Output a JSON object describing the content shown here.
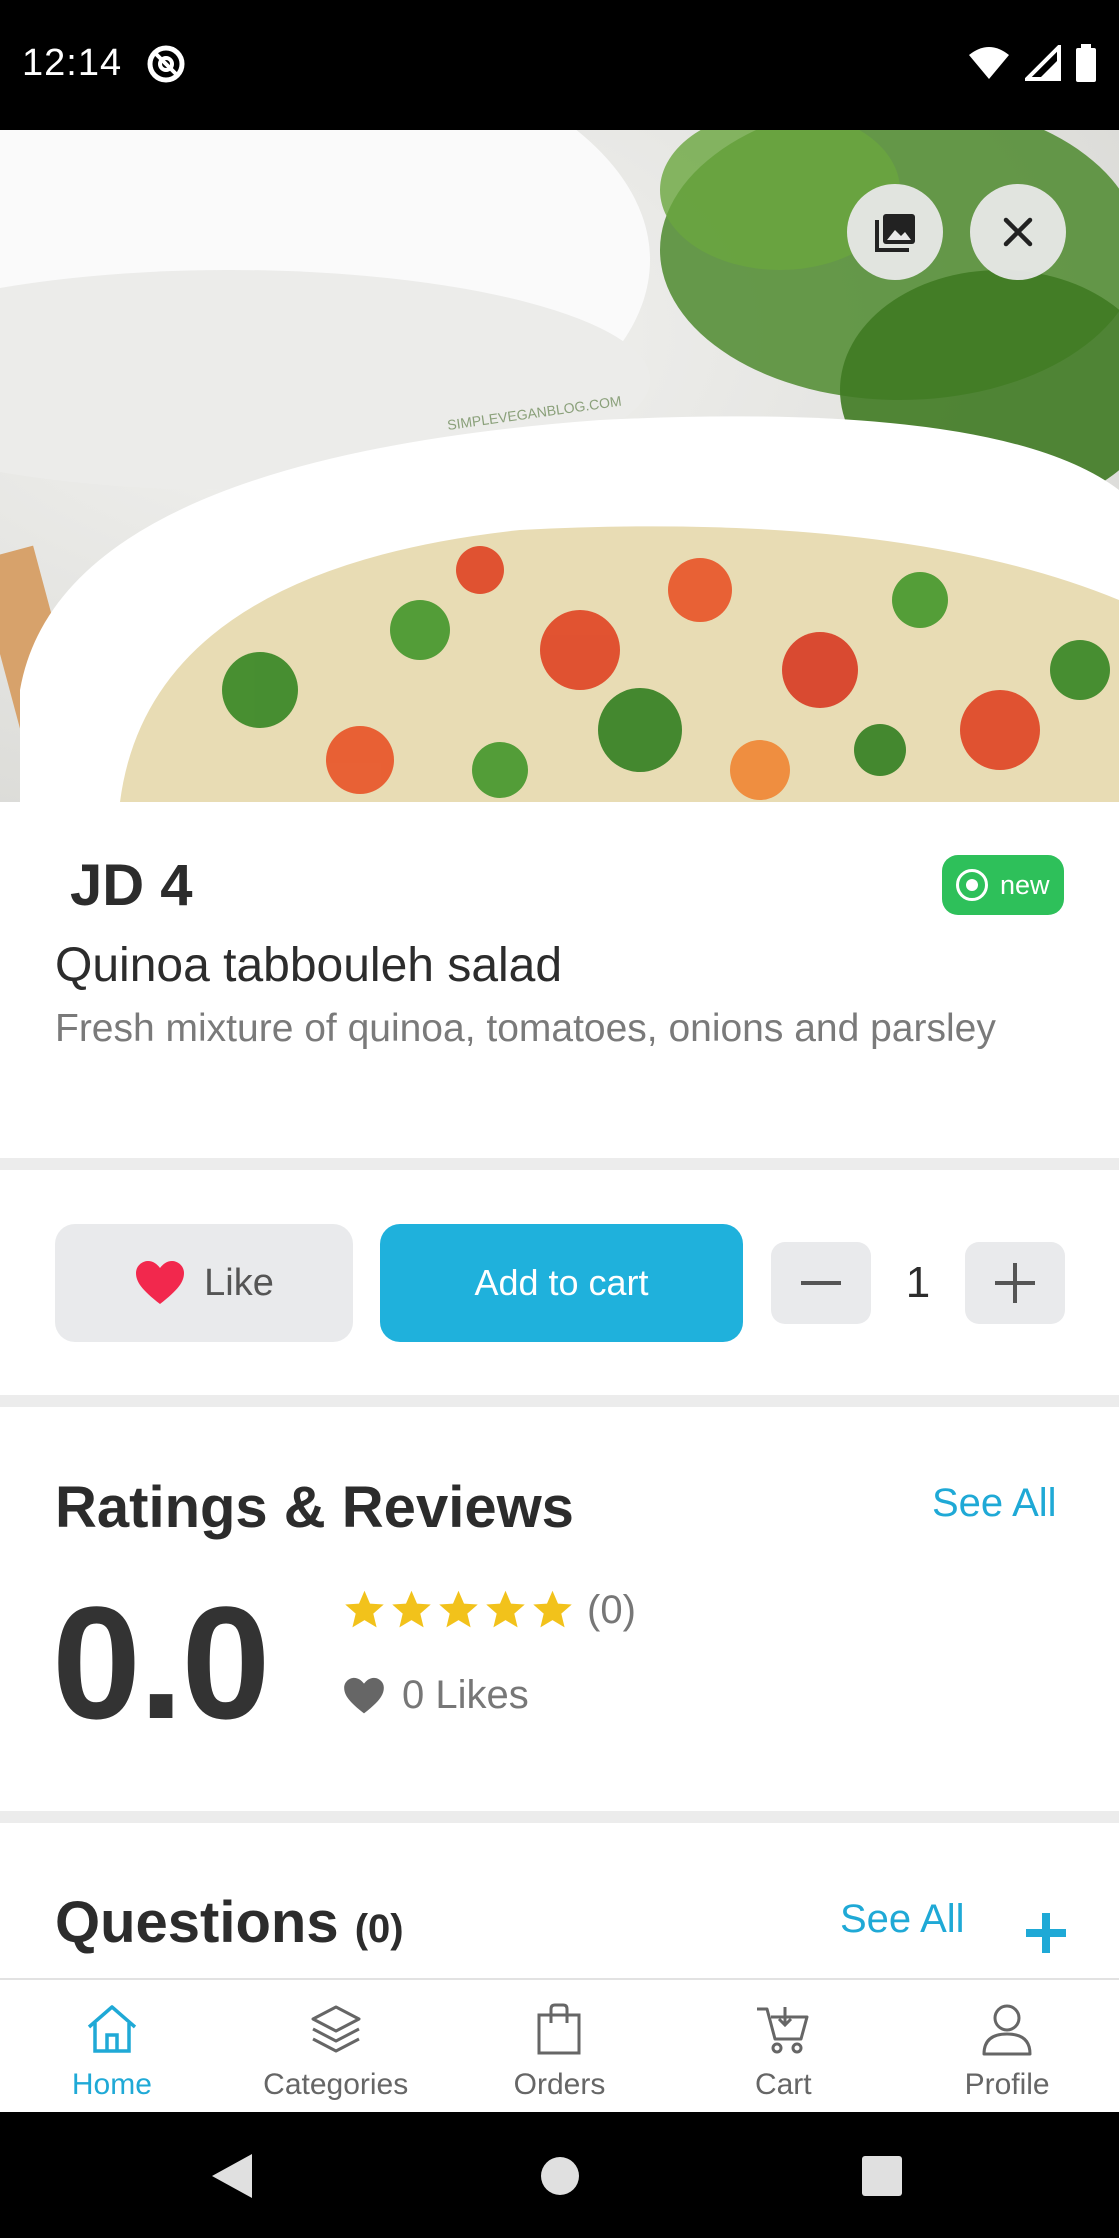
{
  "status_bar": {
    "time": "12:14"
  },
  "hero": {
    "watermark": "SIMPLEVEGANBLOG.COM"
  },
  "product": {
    "price": "JD 4",
    "badge": "new",
    "title": "Quinoa tabbouleh salad",
    "description": "Fresh mixture of quinoa, tomatoes, onions and parsley"
  },
  "actions": {
    "like_label": "Like",
    "add_to_cart_label": "Add to cart",
    "quantity": "1"
  },
  "ratings": {
    "title": "Ratings & Reviews",
    "see_all": "See All",
    "score": "0.0",
    "stars": 5,
    "count": "(0)",
    "likes": "0 Likes"
  },
  "questions": {
    "title": "Questions",
    "count": "(0)",
    "see_all": "See All"
  },
  "bottom_nav": {
    "items": [
      {
        "label": "Home",
        "icon": "home-icon",
        "active": true
      },
      {
        "label": "Categories",
        "icon": "layers-icon"
      },
      {
        "label": "Orders",
        "icon": "bag-icon"
      },
      {
        "label": "Cart",
        "icon": "cart-icon"
      },
      {
        "label": "Profile",
        "icon": "user-icon"
      }
    ]
  },
  "colors": {
    "accent": "#1fb1dc",
    "badge_green": "#2ec05a",
    "heart_red": "#f2284d",
    "star_yellow": "#f2c21b"
  }
}
